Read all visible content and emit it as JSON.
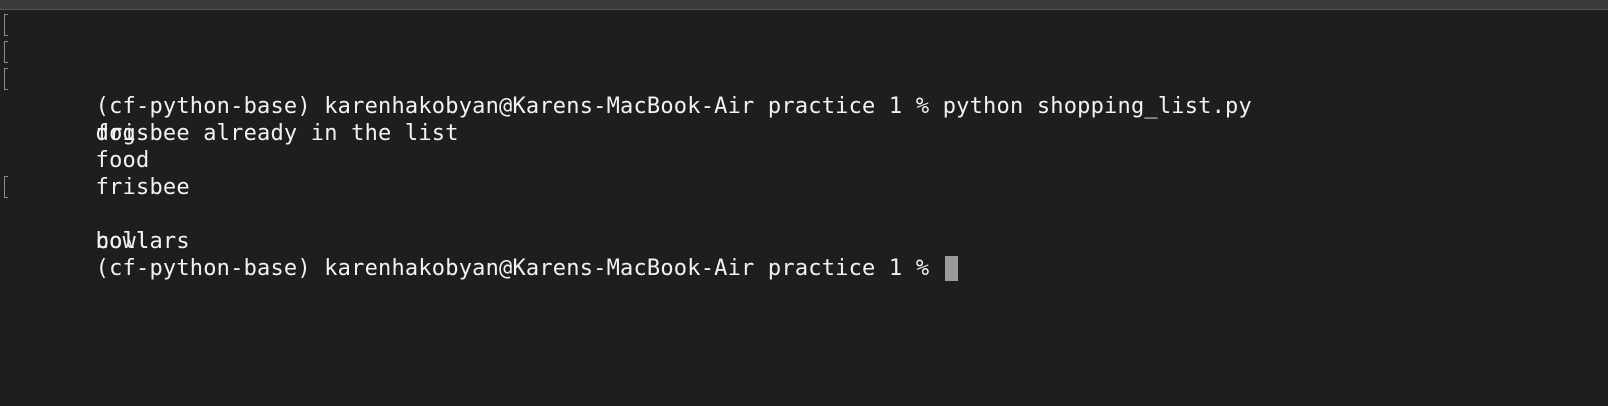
{
  "terminal": {
    "lines": [
      {
        "text": "",
        "marked": true
      },
      {
        "text": "(cf-python-base) karenhakobyan@Karens-MacBook-Air practice 1 % python shopping_list.py",
        "marked": true
      },
      {
        "text": "frisbee already in the list",
        "marked": true
      },
      {
        "text": "dog",
        "marked": false
      },
      {
        "text": "food",
        "marked": false
      },
      {
        "text": "frisbee",
        "marked": false
      },
      {
        "text": "bowl",
        "marked": true
      },
      {
        "text": "collars",
        "marked": false
      }
    ],
    "prompt": "(cf-python-base) karenhakobyan@Karens-MacBook-Air practice 1 % "
  }
}
